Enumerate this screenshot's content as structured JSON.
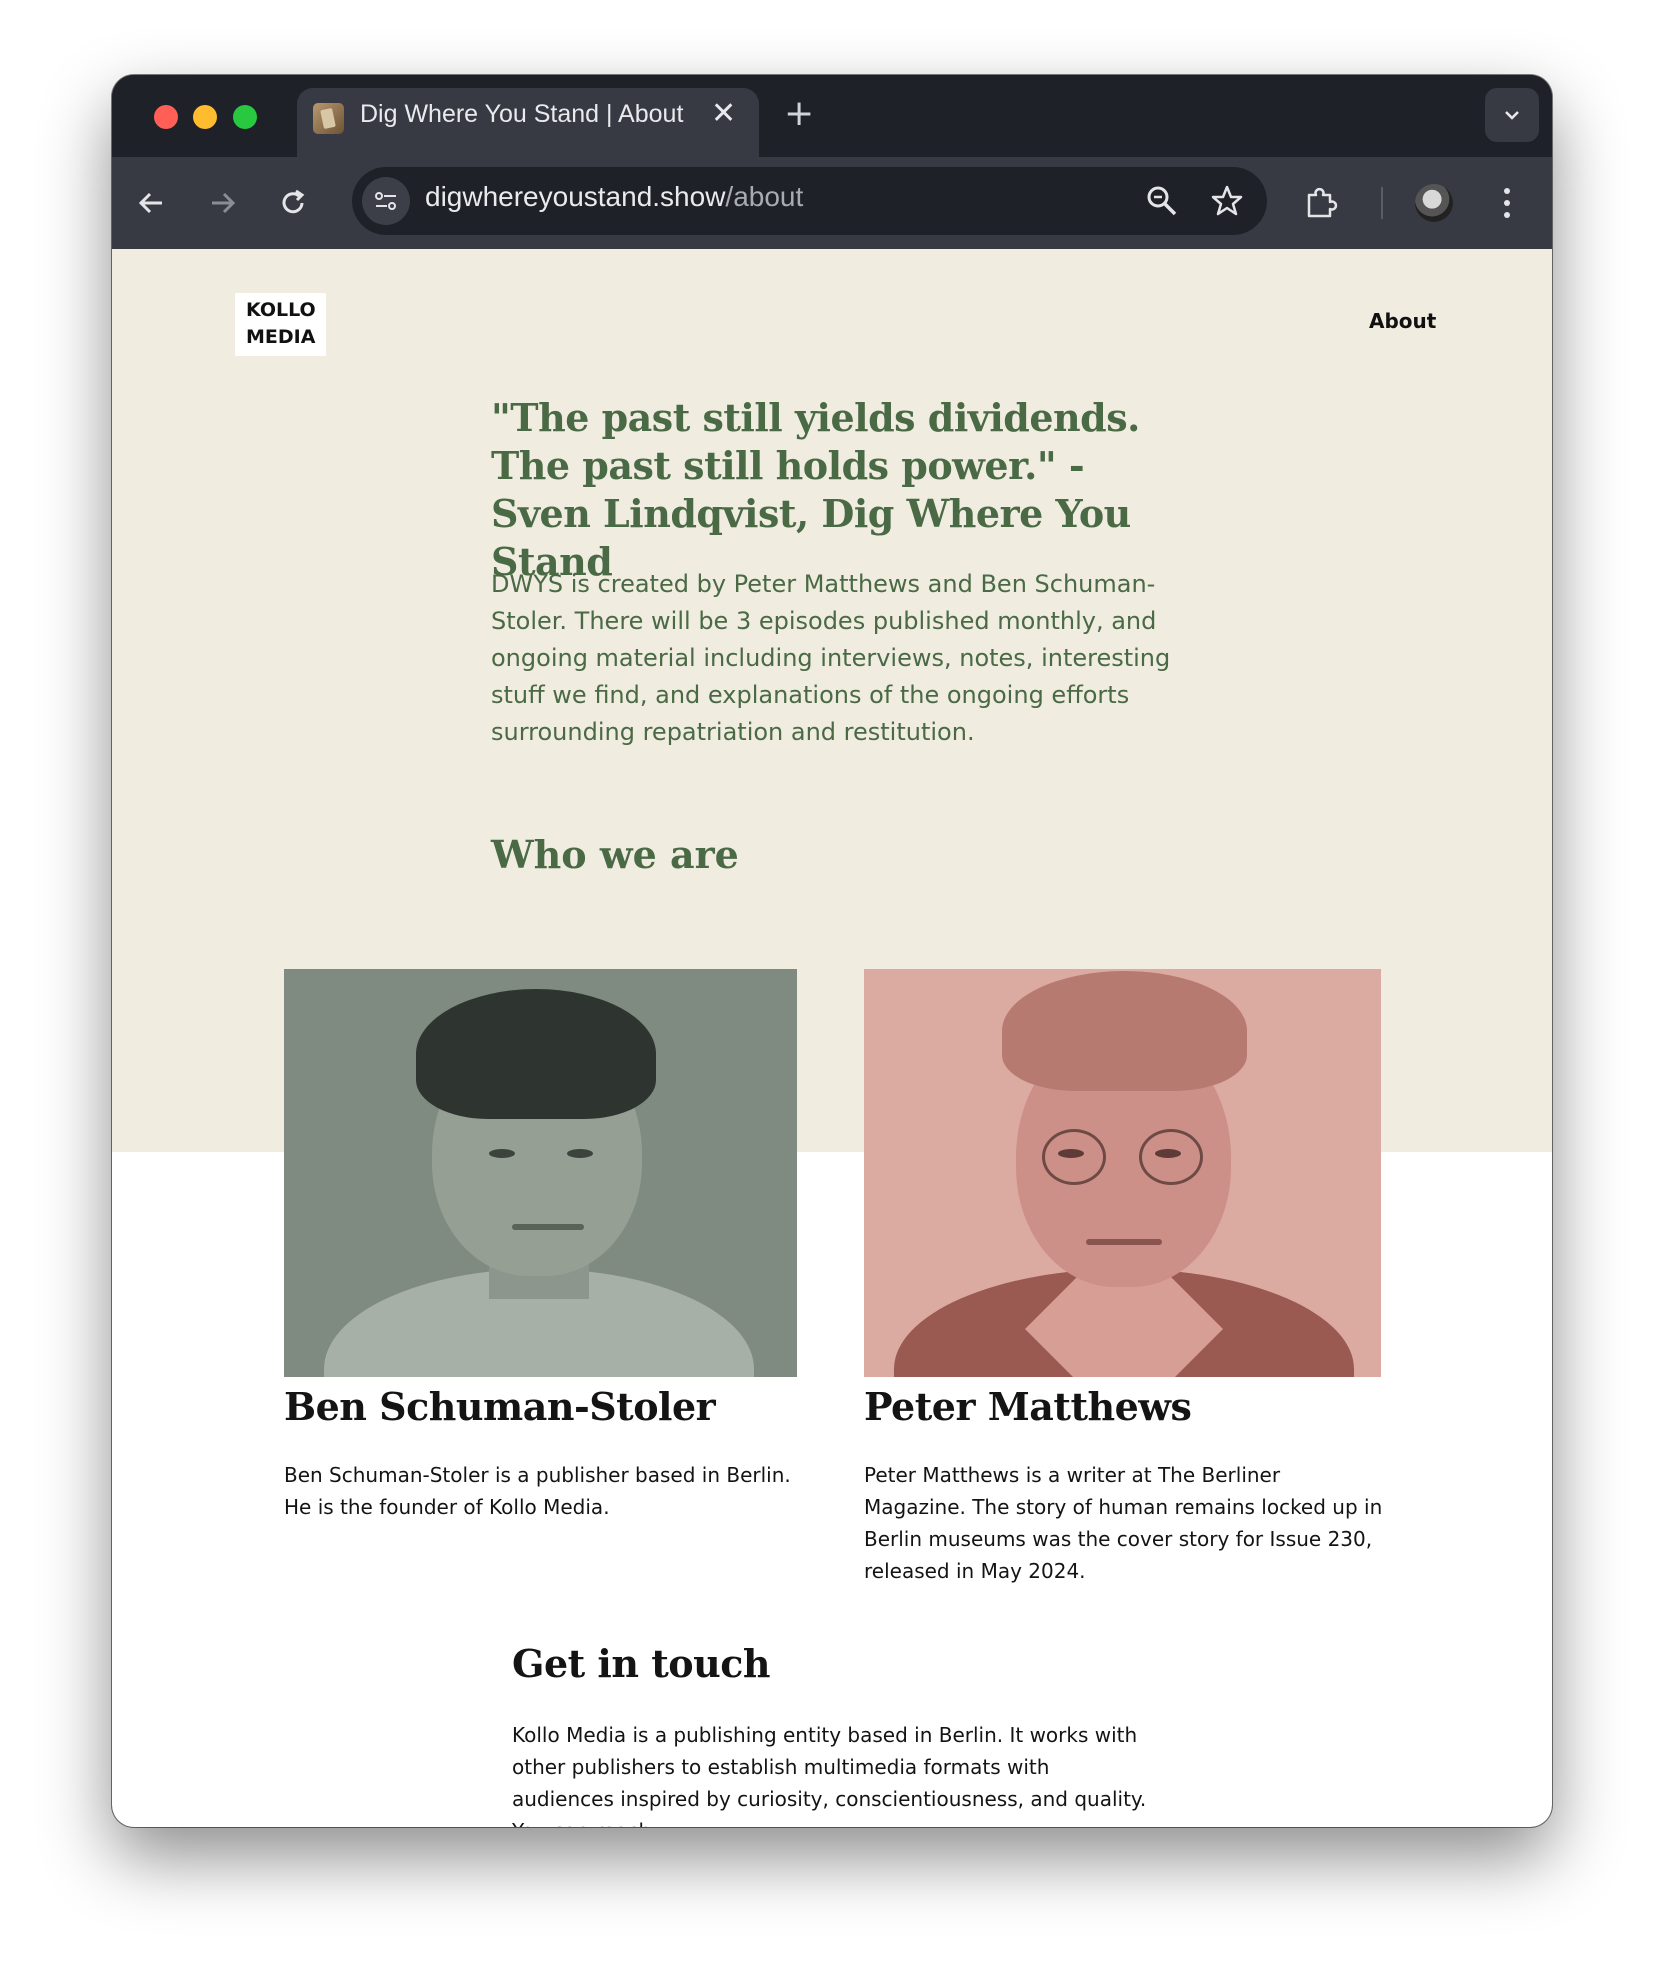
{
  "browser": {
    "tab_title": "Dig Where You Stand | About",
    "tab_close": "✕",
    "new_tab": "+",
    "tab_menu_icon": "chevron-down-icon",
    "url_host": "digwhereyoustand.show",
    "url_path": "/about",
    "icons": {
      "back": "arrow-left-icon",
      "forward": "arrow-right-icon",
      "reload": "reload-icon",
      "site_controls": "tune-icon",
      "zoom": "zoom-icon",
      "bookmark": "star-icon",
      "extensions": "puzzle-icon",
      "profile": "avatar",
      "menu": "kebab-menu-icon"
    }
  },
  "header": {
    "logo_line1": "KOLLO",
    "logo_line2": "MEDIA",
    "nav_about": "About"
  },
  "hero": {
    "quote": "\"The past still yields dividends. The past still holds power.\" - Sven Lindqvist, Dig Where You Stand",
    "intro": "DWYS is created by Peter Matthews and Ben Schuman-Stoler. There will be 3 episodes published monthly, and ongoing material including interviews, notes, interesting stuff we find, and explanations of the ongoing efforts surrounding repatriation and restitution.",
    "who_heading": "Who we are"
  },
  "people": [
    {
      "name": "Ben Schuman-Stoler",
      "bio": "Ben Schuman-Stoler is a publisher based in Berlin. He is the founder of Kollo Media."
    },
    {
      "name": "Peter Matthews",
      "bio": "Peter Matthews is a writer at The Berliner Magazine. The story of human remains locked up in Berlin museums was the cover story for Issue 230, released in May 2024."
    }
  ],
  "contact": {
    "heading": "Get in touch",
    "body": "Kollo Media is a publishing entity based in Berlin. It works with other publishers to establish multimedia formats with audiences inspired by curiosity, conscientiousness, and quality. You can reach"
  },
  "colors": {
    "hero_bg": "#f0ece0",
    "accent_green": "#4a6a45",
    "ben_photo_tint": "#7f8a80",
    "peter_photo_tint": "#dbaba2"
  }
}
